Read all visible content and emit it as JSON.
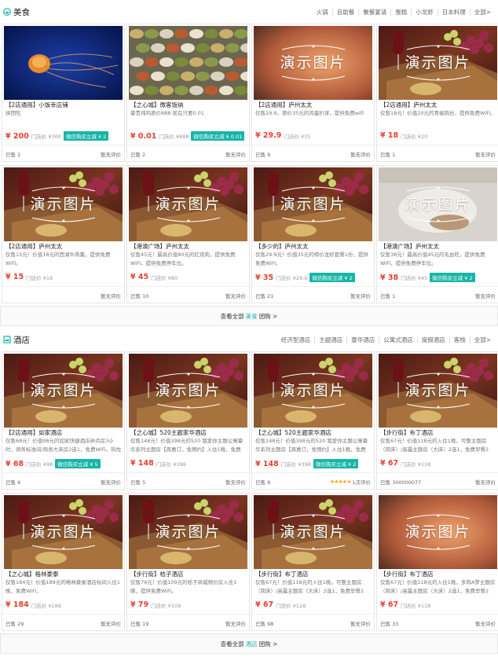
{
  "colors": {
    "accent": "#17b5a8",
    "price": "#e5402f"
  },
  "food": {
    "icon": "food-bowl-icon",
    "title": "美食",
    "categories": [
      "火锅",
      "自助餐",
      "聚餐宴请",
      "蛋糕",
      "小龙虾",
      "日本料理",
      "全部>"
    ],
    "cards": [
      {
        "image": "jellyfish",
        "title": "【2店通用】小饭幸店铺",
        "desc": "拼团吃",
        "price": "¥ 200",
        "oprice": "门店价 ¥300",
        "promo": "微信购买立减 ¥ 2",
        "sold": "已售 2",
        "rating": "暂无评价"
      },
      {
        "image": "banquet",
        "title": "【之心城】微客饭纳",
        "desc": "豪贵炖鸡原价888 现在只要0.01",
        "price": "¥ 0.01",
        "oprice": "门店价 ¥888",
        "promo": "微信购买立减 ¥ 0.01",
        "sold": "已售 2",
        "rating": "暂无评价"
      },
      {
        "image": "blur",
        "title": "【2店通用】庐州太太",
        "desc": "仅售29.9，原价35元的鸡蛋扒饼，提供免费wifi",
        "price": "¥ 29.9",
        "oprice": "门店价 ¥35",
        "promo": "",
        "sold": "已售 9",
        "rating": "暂无评价"
      },
      {
        "image": "wine",
        "title": "【2店通用】庐州太太",
        "desc": "仅售18元！价值20元的青椒肉丝，提供免费WiFi。",
        "price": "¥ 18",
        "oprice": "门店价 ¥20",
        "promo": "",
        "sold": "已售 1",
        "rating": "暂无评价"
      },
      {
        "image": "wine",
        "title": "【2店通用】庐州太太",
        "desc": "仅售15元！价值18元的西湖牛肉羹，提供免费WiFi。",
        "price": "¥ 15",
        "oprice": "门店价 ¥18",
        "promo": "",
        "sold": "",
        "rating": "暂无评价"
      },
      {
        "image": "wine",
        "title": "【港澳广场】庐州太太",
        "desc": "仅售45元！最高价值80元的红烧肉，提供免费WiFi，提供免费停车位。",
        "price": "¥ 45",
        "oprice": "门店价 ¥80",
        "promo": "",
        "sold": "已售 10",
        "rating": "暂无评价"
      },
      {
        "image": "wine",
        "title": "【多少的】庐州太太",
        "desc": "仅售29.9元！价值35元的特价龙虾套餐1份，提供免费WiFi。",
        "price": "¥ 35",
        "oprice": "门店价 ¥29.9",
        "promo": "微信购买立减 ¥ 2",
        "sold": "已售 21",
        "rating": "暂无评价"
      },
      {
        "image": "plate",
        "title": "【港澳广场】庐州太太",
        "desc": "仅售38元！最高价值45元的毛血旺，提供免费WiFi，提供免费停车位。",
        "price": "¥ 38",
        "oprice": "门店价 ¥45",
        "promo": "微信购买立减 ¥ 2",
        "sold": "已售 1",
        "rating": "暂无评价"
      }
    ],
    "viewall": {
      "pre": "查看全部",
      "hl": "美食",
      "post": "团购 >"
    }
  },
  "hotel": {
    "icon": "hotel-bed-icon",
    "title": "酒店",
    "categories": [
      "经济型酒店",
      "主题酒店",
      "豪华酒店",
      "公寓式酒店",
      "度假酒店",
      "客栈",
      "全部>"
    ],
    "cards": [
      {
        "image": "wine",
        "title": "【2店通用】如家酒店",
        "desc": "仅售68元！价值98元的如家快捷酒店钟点房3小时，商务标准间/商务大床房2选1，免费WiFi。热忱欢迎",
        "price": "¥ 68",
        "oprice": "门店价 ¥98",
        "promo": "微信购买立减 ¥ 5",
        "sold": "已售 6",
        "rating": "暂无评价",
        "stars": ""
      },
      {
        "image": "wine",
        "title": "【之心城】520主题家华酒店",
        "desc": "仅售148元！价值398元的520 我爱你主题公寓豪华系列主题房【周惠订，免预约】入住1晚，免费",
        "price": "¥ 148",
        "oprice": "门店价 ¥398",
        "promo": "",
        "sold": "已售 5",
        "rating": "暂无评价",
        "stars": ""
      },
      {
        "image": "wine",
        "title": "【之心城】520主题家华酒店",
        "desc": "仅售148元！价值398元的520 我爱你主题公寓豪华系列主题房【周惠订，免预约】入住1晚，免费",
        "price": "¥ 148",
        "oprice": "门店价 ¥398",
        "promo": "微信购买立减 ¥ 2",
        "sold": "已售 8",
        "rating": "1次评价",
        "stars": "★★★★★"
      },
      {
        "image": "wine",
        "title": "【步行街】布丁酒店",
        "desc": "仅售67元！价值118元的入住1晚，可整主题房（简床）/高露主题房（大床）2选1，免费早餐2份，可连",
        "price": "¥ 67",
        "oprice": "门店价 ¥118",
        "promo": "",
        "sold": "已售 300000077",
        "rating": "暂无评价",
        "stars": ""
      },
      {
        "image": "wine",
        "title": "【之心城】格林豪泰",
        "desc": "仅售184元！价值189元的格林豪泰酒店标间入住1晚，免费WiFi。",
        "price": "¥ 184",
        "oprice": "门店价 ¥189",
        "promo": "",
        "sold": "已售 29",
        "rating": "暂无评价",
        "stars": ""
      },
      {
        "image": "wine",
        "title": "【步行街】桔子酒店",
        "desc": "仅售79元！价值109元的桔子商城特价房入住1晚，提供免费WiFi。",
        "price": "¥ 79",
        "oprice": "门店价 ¥109",
        "promo": "",
        "sold": "已售 19",
        "rating": "暂无评价",
        "stars": ""
      },
      {
        "image": "wine",
        "title": "【步行街】布丁酒店",
        "desc": "仅售67元！价值118元的入住1晚，可整主题房（简床）/高露主题房（大床）2选1，免费早餐2份，可连",
        "price": "¥ 67",
        "oprice": "门店价 ¥118",
        "promo": "",
        "sold": "已售 98",
        "rating": "暂无评价",
        "stars": ""
      },
      {
        "image": "blur",
        "title": "【步行街】布丁酒店",
        "desc": "仅售67元！价值118元的入住1晚，多和A梦主题房（简床）/高露主题房（大床）2选1，免费早餐2份，可连",
        "price": "¥ 67",
        "oprice": "门店价 ¥118",
        "promo": "",
        "sold": "已售 33",
        "rating": "暂无评价",
        "stars": ""
      }
    ],
    "viewall": {
      "pre": "查看全部",
      "hl": "酒店",
      "post": "团购 >"
    }
  },
  "demo_text": "演示图片"
}
